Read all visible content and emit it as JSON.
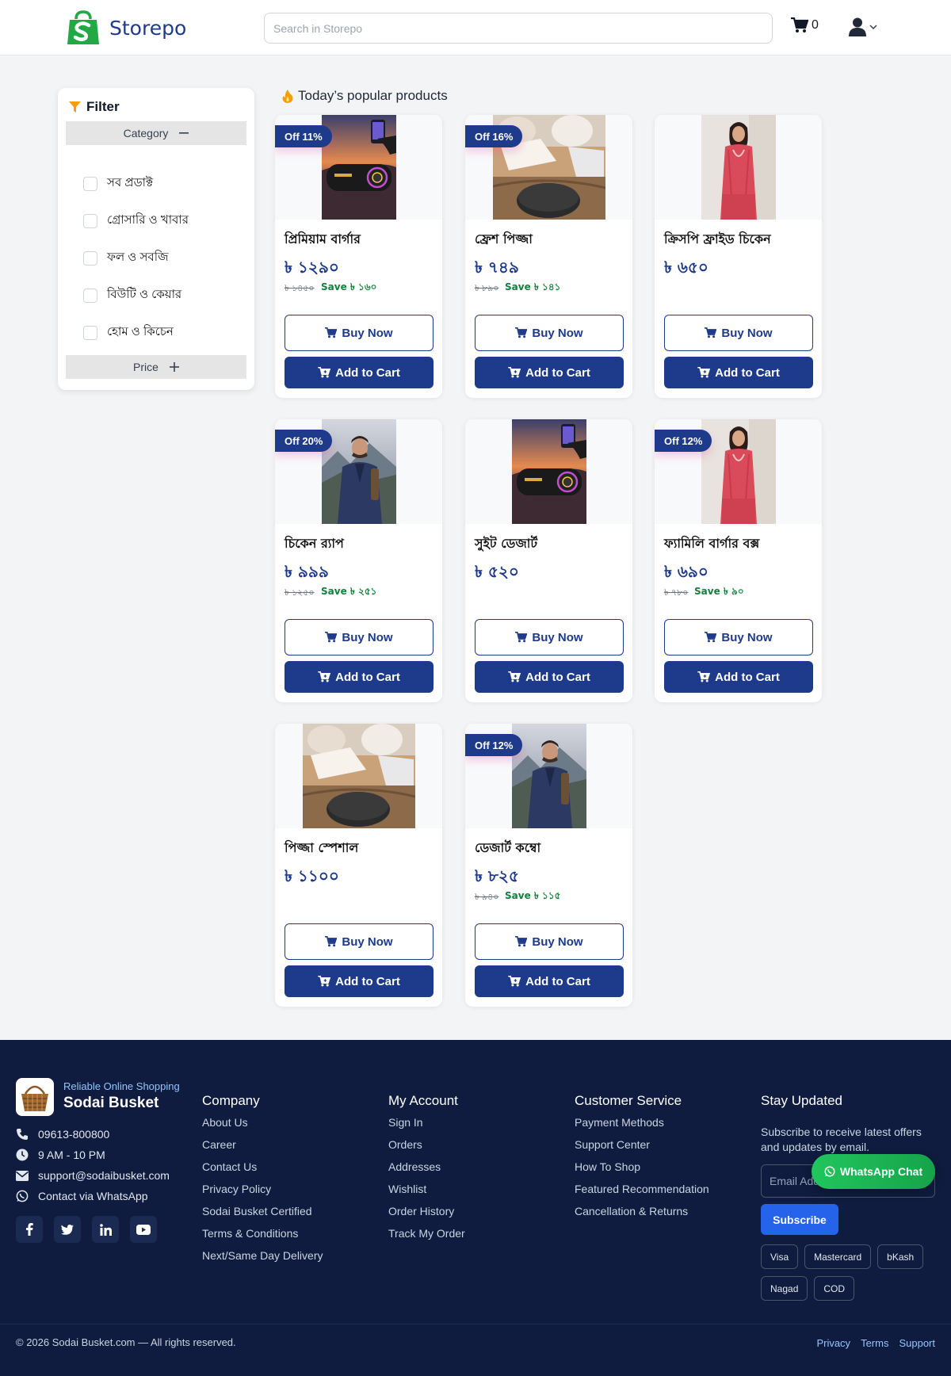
{
  "header": {
    "brand": "Storepo",
    "search_placeholder": "Search in Storepo",
    "cart_count": "0"
  },
  "filter": {
    "title": "Filter",
    "category_label": "Category",
    "categories": [
      "সব প্রডাক্ট",
      "গ্রোসারি ও খাবার",
      "ফল ও সবজি",
      "বিউটি ও কেয়ার",
      "হোম ও কিচেন"
    ],
    "price_label": "Price"
  },
  "section": {
    "title": "Today’s popular products"
  },
  "products": [
    {
      "name": "প্রিমিয়াম বার্গার",
      "price": "৳ ১২৯০",
      "old_price": "৳ ১৪৫০",
      "save": "Save ৳ ১৬০",
      "badge": "Off 11%",
      "image": "speaker-sunset"
    },
    {
      "name": "ফ্রেশ পিজ্জা",
      "price": "৳ ৭৪৯",
      "old_price": "৳ ৮৯০",
      "save": "Save ৳ ১৪১",
      "badge": "Off 16%",
      "image": "study-table"
    },
    {
      "name": "ক্রিসপি ফ্রাইড চিকেন",
      "price": "৳ ৬৫০",
      "old_price": "",
      "save": "",
      "badge": "",
      "image": "red-dress"
    },
    {
      "name": "চিকেন র‍্যাপ",
      "price": "৳ ৯৯৯",
      "old_price": "৳ ১২৫০",
      "save": "Save ৳ ২৫১",
      "badge": "Off 20%",
      "image": "man-mountain"
    },
    {
      "name": "সুইট ডেজার্ট",
      "price": "৳ ৫২০",
      "old_price": "",
      "save": "",
      "badge": "",
      "image": "speaker-sunset"
    },
    {
      "name": "ফ্যামিলি বার্গার বক্স",
      "price": "৳ ৬৯০",
      "old_price": "৳ ৭৮০",
      "save": "Save ৳ ৯০",
      "badge": "Off 12%",
      "image": "red-dress"
    },
    {
      "name": "পিজ্জা স্পেশাল",
      "price": "৳ ১১০০",
      "old_price": "",
      "save": "",
      "badge": "",
      "image": "study-table"
    },
    {
      "name": "ডেজার্ট কম্বো",
      "price": "৳ ৮২৫",
      "old_price": "৳ ৯৪০",
      "save": "Save ৳ ১১৫",
      "badge": "Off 12%",
      "image": "man-mountain"
    }
  ],
  "buttons": {
    "buy_now": "Buy Now",
    "add_to_cart": "Add to Cart"
  },
  "footer": {
    "tagline": "Reliable Online Shopping",
    "brand": "Sodai Busket",
    "phone": "09613-800800",
    "hours": "9 AM - 10 PM",
    "email": "support@sodaibusket.com",
    "whatsapp": "Contact via WhatsApp",
    "columns": [
      {
        "title": "Company",
        "links": [
          "About Us",
          "Career",
          "Contact Us",
          "Privacy Policy",
          "Sodai Busket Certified",
          "Terms & Conditions",
          "Next/Same Day Delivery"
        ]
      },
      {
        "title": "My Account",
        "links": [
          "Sign In",
          "Orders",
          "Addresses",
          "Wishlist",
          "Order History",
          "Track My Order"
        ]
      },
      {
        "title": "Customer Service",
        "links": [
          "Payment Methods",
          "Support Center",
          "How To Shop",
          "Featured Recommendation",
          "Cancellation & Returns"
        ]
      }
    ],
    "stay_title": "Stay Updated",
    "stay_text": "Subscribe to receive latest offers and updates by email.",
    "email_placeholder": "Email Address",
    "subscribe": "Subscribe",
    "payments": [
      "Visa",
      "Mastercard",
      "bKash",
      "Nagad",
      "COD"
    ],
    "whatsapp_chat": "WhatsApp Chat",
    "copyright": "© 2026 Sodai Busket.com — All rights reserved.",
    "bottom_links": [
      "Privacy",
      "Terms",
      "Support"
    ]
  },
  "colors": {
    "primary": "#1e3a8a",
    "brand_green": "#22a845",
    "footer_bg": "#0f1c3f",
    "save_green": "#15803d",
    "subscribe_blue": "#2563eb"
  }
}
